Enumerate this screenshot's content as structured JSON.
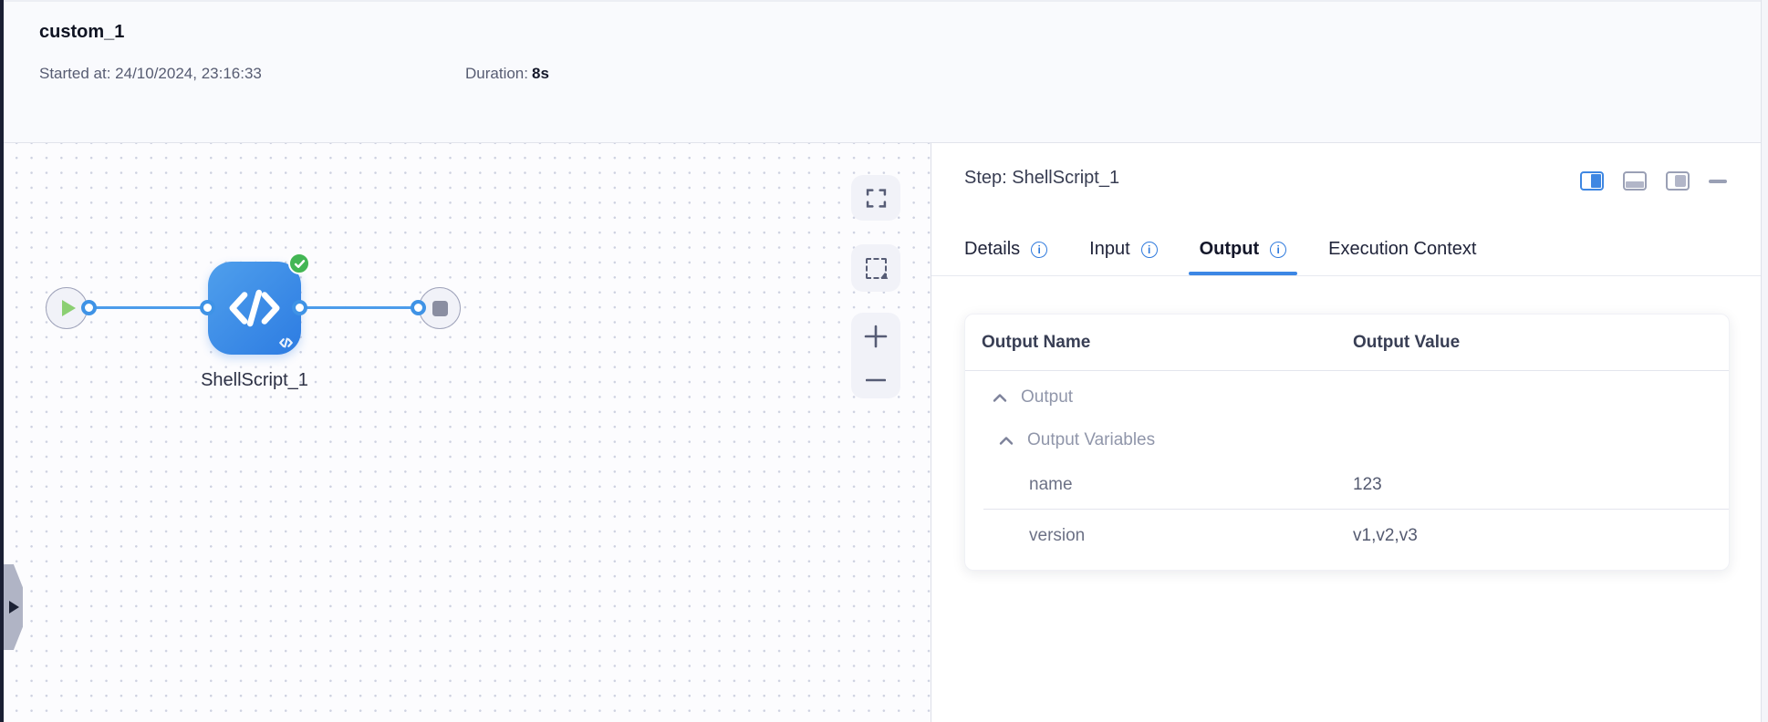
{
  "header": {
    "title": "custom_1",
    "started_label": "Started at:",
    "started_value": "24/10/2024, 23:16:33",
    "duration_label": "Duration:",
    "duration_value": "8s"
  },
  "canvas": {
    "node": {
      "label": "ShellScript_1",
      "icon": "code-icon",
      "status": "success"
    }
  },
  "panel": {
    "step_title": "Step: ShellScript_1",
    "tabs": [
      {
        "label": "Details",
        "has_info": true,
        "active": false
      },
      {
        "label": "Input",
        "has_info": true,
        "active": false
      },
      {
        "label": "Output",
        "has_info": true,
        "active": true
      },
      {
        "label": "Execution Context",
        "has_info": false,
        "active": false
      }
    ],
    "output_table": {
      "columns": [
        "Output Name",
        "Output Value"
      ],
      "groups": [
        {
          "label": "Output",
          "expanded": true
        },
        {
          "label": "Output Variables",
          "expanded": true
        }
      ],
      "rows": [
        {
          "name": "name",
          "value": "123"
        },
        {
          "name": "version",
          "value": "v1,v2,v3"
        }
      ]
    }
  },
  "colors": {
    "accent_blue": "#3c87e5",
    "edge_blue": "#4c9ceb",
    "node_gradient_start": "#4f9fec",
    "node_gradient_end": "#2d7ce2",
    "success_green": "#43b654",
    "rail_dark": "#1a1f33"
  }
}
